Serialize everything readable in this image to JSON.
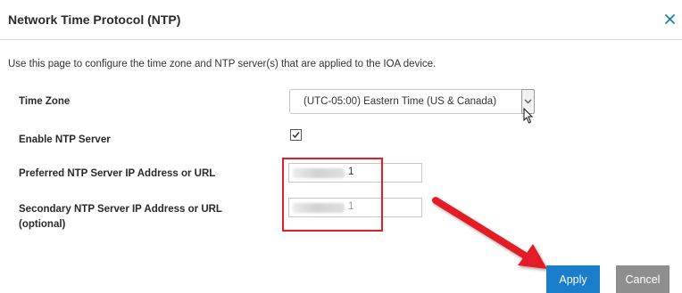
{
  "dialog": {
    "title": "Network Time Protocol (NTP)",
    "description": "Use this page to configure the time zone and NTP server(s) that are applied to the IOA device."
  },
  "form": {
    "time_zone_label": "Time Zone",
    "time_zone_value": "(UTC-05:00) Eastern Time (US & Canada)",
    "enable_ntp_label": "Enable NTP Server",
    "enable_ntp_checked": true,
    "preferred_label": "Preferred NTP Server IP Address or URL",
    "preferred_value_visible": "1",
    "secondary_label": "Secondary NTP Server IP Address or URL (optional)",
    "secondary_value_visible": "1"
  },
  "buttons": {
    "apply": "Apply",
    "cancel": "Cancel"
  },
  "colors": {
    "apply": "#1a7ecb",
    "cancel": "#8e8e8e",
    "annotation": "#e31e26",
    "close_icon": "#1f7fa8"
  },
  "icons": [
    "close-icon",
    "chevron-down-icon",
    "checkmark-icon",
    "mouse-pointer-icon",
    "annotation-arrow"
  ]
}
